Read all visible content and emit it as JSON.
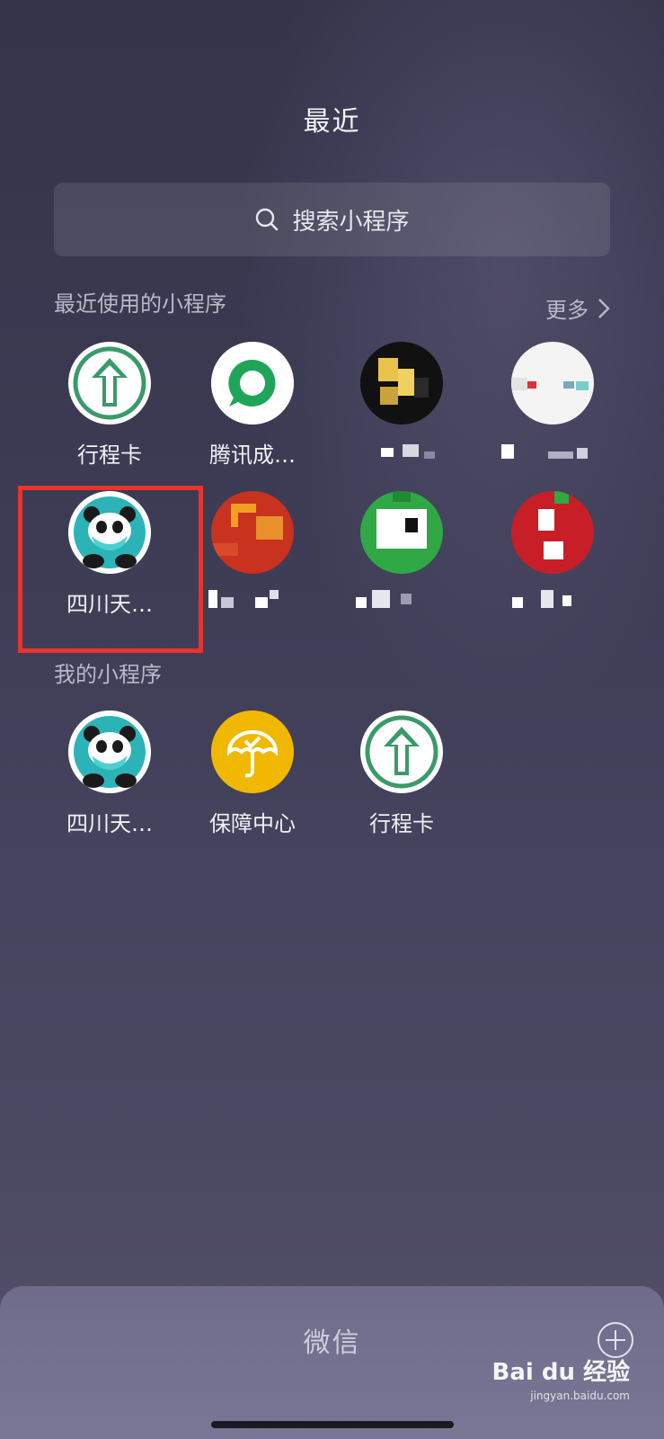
{
  "header": {
    "title": "最近"
  },
  "search": {
    "label": "搜索小程序"
  },
  "recent": {
    "section_title": "最近使用的小程序",
    "more_label": "更多",
    "items": [
      {
        "name": "行程卡",
        "icon": "green-arrow-up-icon"
      },
      {
        "name": "腾讯成…",
        "icon": "green-chat-bubble-icon"
      },
      {
        "name": "",
        "icon": "pixelated-icon"
      },
      {
        "name": "",
        "icon": "pixelated-icon"
      },
      {
        "name": "四川天…",
        "icon": "panda-mask-icon"
      },
      {
        "name": "",
        "icon": "pixelated-icon"
      },
      {
        "name": "",
        "icon": "pixelated-icon"
      },
      {
        "name": "",
        "icon": "pixelated-icon"
      }
    ]
  },
  "mine": {
    "section_title": "我的小程序",
    "items": [
      {
        "name": "四川天…",
        "icon": "panda-mask-icon"
      },
      {
        "name": "保障中心",
        "icon": "umbrella-check-icon"
      },
      {
        "name": "行程卡",
        "icon": "green-arrow-up-icon"
      }
    ]
  },
  "bottom_bar": {
    "title": "微信"
  },
  "watermark": {
    "brand": "Bai du 经验",
    "url": "jingyan.baidu.com"
  },
  "colors": {
    "accent_green": "#3a9a6a",
    "highlight_red": "#e8342c",
    "yellow": "#f0b800",
    "teal": "#2bb3b8"
  }
}
